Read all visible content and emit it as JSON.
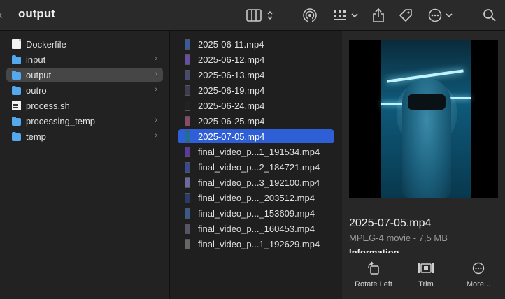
{
  "toolbar": {
    "title": "output",
    "view_icon": "column-view-icon",
    "airdrop_icon": "airdrop-icon",
    "group_icon": "group-icon",
    "share_icon": "share-icon",
    "tag_icon": "tag-icon",
    "more_icon": "ellipsis-circle-icon",
    "search_icon": "search-icon"
  },
  "column1": {
    "items": [
      {
        "label": "Dockerfile",
        "kind": "doc",
        "chevron": false,
        "selected": false
      },
      {
        "label": "input",
        "kind": "folder",
        "chevron": true,
        "selected": false
      },
      {
        "label": "output",
        "kind": "folder",
        "chevron": true,
        "selected": true
      },
      {
        "label": "outro",
        "kind": "folder",
        "chevron": true,
        "selected": false
      },
      {
        "label": "process.sh",
        "kind": "sh",
        "chevron": false,
        "selected": false
      },
      {
        "label": "processing_temp",
        "kind": "folder",
        "chevron": true,
        "selected": false
      },
      {
        "label": "temp",
        "kind": "folder",
        "chevron": true,
        "selected": false
      }
    ]
  },
  "column2": {
    "items": [
      {
        "label": "2025-06-11.mp4",
        "thumb": "#3b5a9a",
        "selected": false
      },
      {
        "label": "2025-06-12.mp4",
        "thumb": "#6a4fa0",
        "selected": false
      },
      {
        "label": "2025-06-13.mp4",
        "thumb": "#4a4a70",
        "selected": false
      },
      {
        "label": "2025-06-19.mp4",
        "thumb": "#3d3d52",
        "selected": false
      },
      {
        "label": "2025-06-24.mp4",
        "thumb": "#222222",
        "selected": false
      },
      {
        "label": "2025-06-25.mp4",
        "thumb": "#8a4a6a",
        "selected": false
      },
      {
        "label": "2025-07-05.mp4",
        "thumb": "#1f6f9a",
        "selected": true
      },
      {
        "label": "final_video_p...1_191534.mp4",
        "thumb": "#5a3a9a",
        "selected": false
      },
      {
        "label": "final_video_p...2_184721.mp4",
        "thumb": "#3a4a8a",
        "selected": false
      },
      {
        "label": "final_video_p...3_192100.mp4",
        "thumb": "#6a6aa0",
        "selected": false
      },
      {
        "label": "final_video_p..._203512.mp4",
        "thumb": "#2a3a6a",
        "selected": false
      },
      {
        "label": "final_video_p..._153609.mp4",
        "thumb": "#3a5a8a",
        "selected": false
      },
      {
        "label": "final_video_p..._160453.mp4",
        "thumb": "#555566",
        "selected": false
      },
      {
        "label": "final_video_p...1_192629.mp4",
        "thumb": "#666666",
        "selected": false
      }
    ]
  },
  "preview": {
    "file_name": "2025-07-05.mp4",
    "kind_size": "MPEG-4 movie - 7,5 MB",
    "info_heading": "Information",
    "actions": [
      {
        "label": "Rotate Left",
        "icon": "rotate-left-icon"
      },
      {
        "label": "Trim",
        "icon": "trim-icon"
      },
      {
        "label": "More...",
        "icon": "more-icon"
      }
    ]
  },
  "colors": {
    "selection_blue": "#2f5fd6",
    "folder_blue": "#55a8ec",
    "sidebar_selected": "#464646"
  }
}
